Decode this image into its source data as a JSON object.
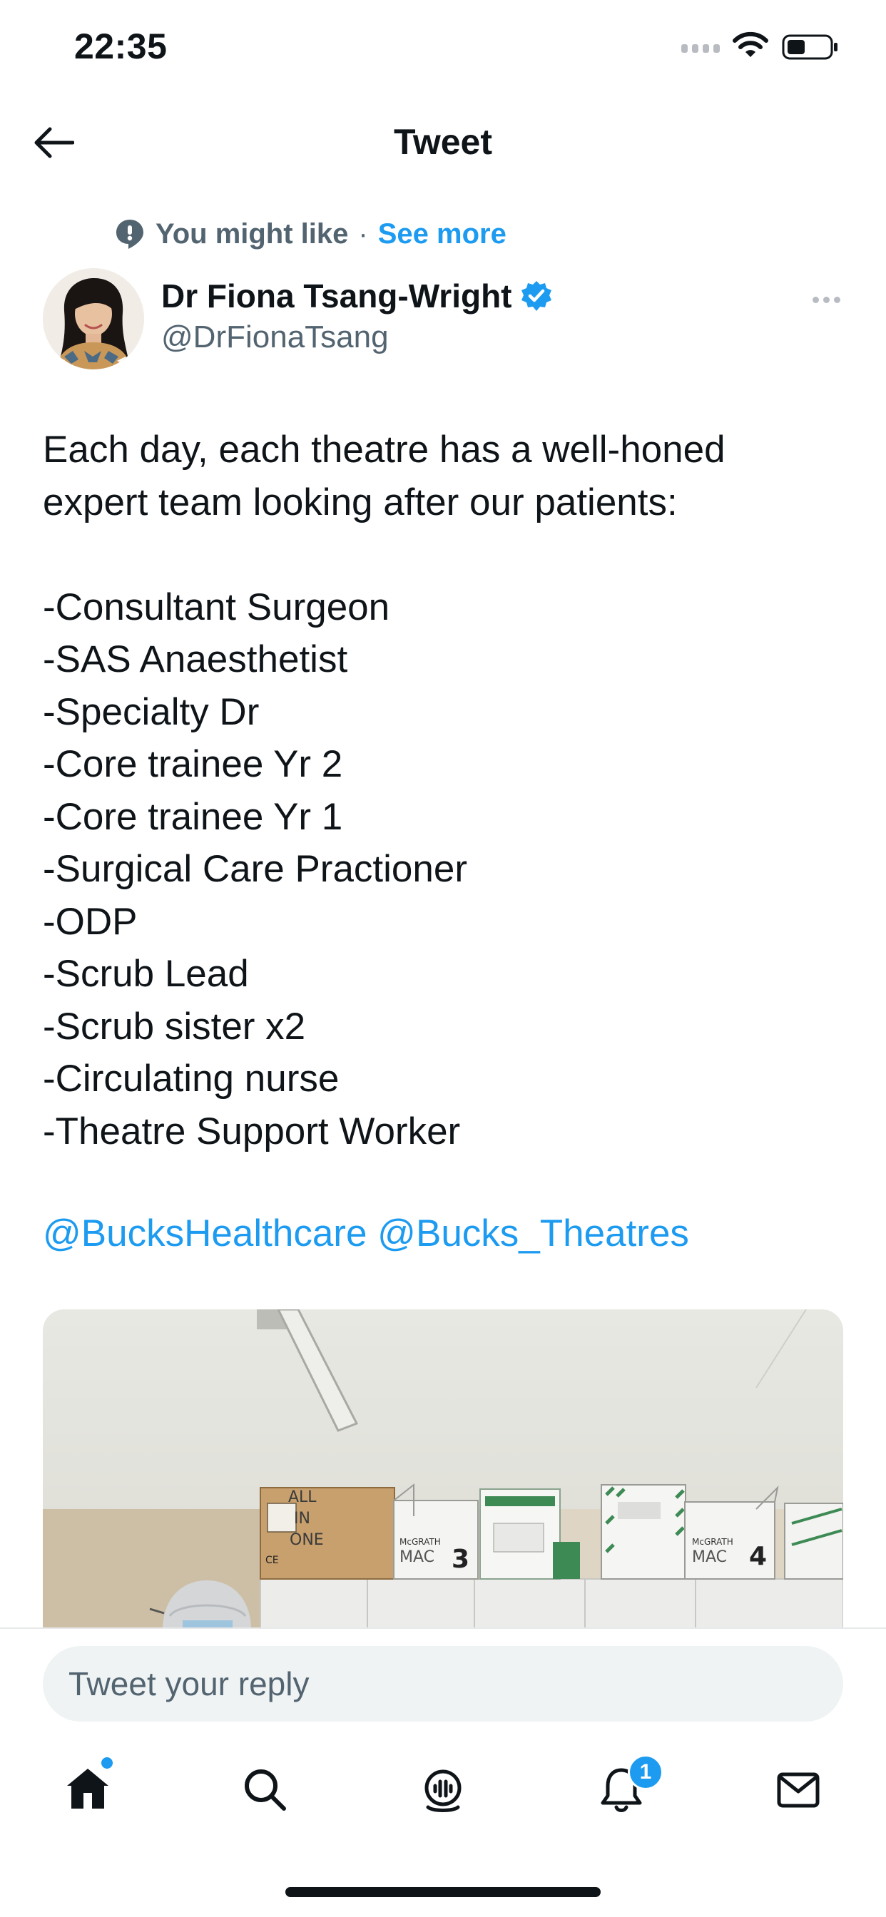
{
  "status_bar": {
    "time": "22:35",
    "signal_icon": "signal-dots-icon",
    "wifi_icon": "wifi-icon",
    "battery_icon": "battery-icon"
  },
  "header": {
    "back_icon": "arrow-left-icon",
    "title": "Tweet"
  },
  "recommendation": {
    "icon": "speech-bubble-icon",
    "label": "You might like",
    "separator": "·",
    "link": "See more"
  },
  "author": {
    "name": "Dr Fiona Tsang-Wright",
    "handle": "@DrFionaTsang",
    "verified_icon": "verified-badge-icon",
    "more_icon": "more-horizontal-icon"
  },
  "tweet": {
    "lines": [
      "Each day, each theatre has a well-honed",
      "expert team looking after our patients:",
      "",
      "-Consultant Surgeon",
      "-SAS Anaesthetist",
      "-Specialty Dr",
      "-Core trainee Yr 2",
      "-Core trainee Yr 1",
      "-Surgical Care Practioner",
      "-ODP",
      "-Scrub Lead",
      "-Scrub sister x2",
      "-Circulating nurse",
      "-Theatre Support Worker"
    ],
    "mentions": [
      "@BucksHealthcare",
      "@Bucks_Theatres"
    ]
  },
  "media": {
    "box_labels": {
      "handwritten": [
        "ALL",
        "IN",
        "ONE"
      ],
      "mac_3_brand": "McGRATH",
      "mac_3_label": "MAC",
      "mac_3_number": "3",
      "mac_4_brand": "McGRATH",
      "mac_4_label": "MAC",
      "mac_4_number": "4",
      "ce_mark": "CE"
    }
  },
  "reply": {
    "placeholder": "Tweet your reply"
  },
  "tab_bar": {
    "tabs": [
      {
        "name": "home",
        "icon": "home-icon",
        "active": true
      },
      {
        "name": "search",
        "icon": "search-icon",
        "active": false
      },
      {
        "name": "spaces",
        "icon": "spaces-icon",
        "active": false
      },
      {
        "name": "notifications",
        "icon": "bell-icon",
        "active": false
      },
      {
        "name": "messages",
        "icon": "mail-icon",
        "active": false
      }
    ],
    "notification_count": "1"
  },
  "colors": {
    "accent": "#1d9bf0",
    "text_primary": "#0f1419",
    "text_secondary": "#536471",
    "input_bg": "#eff3f4"
  }
}
